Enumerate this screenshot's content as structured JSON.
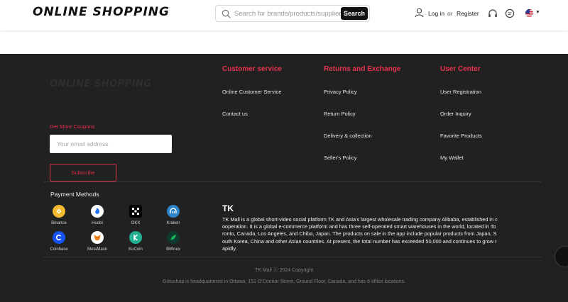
{
  "header": {
    "logo": "ONLINE SHOPPING",
    "search_placeholder": "Search for brands/products/suppliers",
    "search_button": "Search",
    "login": "Log in",
    "or": "or",
    "register": "Register"
  },
  "footer": {
    "logo": "ONLINE SHOPPING",
    "coupon_label": "Get More Coupons",
    "email_placeholder": "Your email address",
    "subscribe": "Subscribe",
    "columns": [
      {
        "title": "Customer service",
        "links": [
          "Online Customer Service",
          "Contact us"
        ]
      },
      {
        "title": "Returns and Exchange",
        "links": [
          "Privacy Policy",
          "Return Policy",
          "Delivery & collection",
          "Seller's Policy"
        ]
      },
      {
        "title": "User Center",
        "links": [
          "User Registration",
          "Order Inquiry",
          "Favorite Products",
          "My Wallet"
        ]
      }
    ],
    "payment_title": "Payment Methods",
    "payments": [
      {
        "label": "Binance",
        "icon": "binance-icon",
        "color": "#f3ba2f"
      },
      {
        "label": "Huobi",
        "icon": "huobi-icon",
        "color": "#1c6ef2"
      },
      {
        "label": "OKX",
        "icon": "okx-icon",
        "color": "#000000"
      },
      {
        "label": "Kraken",
        "icon": "kraken-icon",
        "color": "#2f83c7"
      },
      {
        "label": "Coinbase",
        "icon": "coinbase-icon",
        "color": "#1652f0"
      },
      {
        "label": "MetaMask",
        "icon": "metamask-icon",
        "color": "#f6851b"
      },
      {
        "label": "KuCoin",
        "icon": "kucoin-icon",
        "color": "#23af91"
      },
      {
        "label": "Bitfinex",
        "icon": "bitfinex-icon",
        "color": "#16b157"
      }
    ],
    "tk_title": "TK",
    "tk_description": "TK Mall is a global short-video social platform TK and Asia's largest wholesale trading company Alibaba, established in cooperation. It is a global e-commerce platform and has three self-operated smart warehouses in the world, located in Toronto, Canada, Los Angeles, and Chiba, Japan. The products on sale in the app include popular products from Japan, South Korea, China and other Asian countries. At present, the total number has exceeded 50,000 and continues to grow rapidly.",
    "copyright": "TK Mall  ⓒ 2024 Copyright",
    "address": "Gotushop is headquartered in Ottawa, 151 O'Connor Street, Ground Floor, Canada, and has 6 office locations."
  }
}
